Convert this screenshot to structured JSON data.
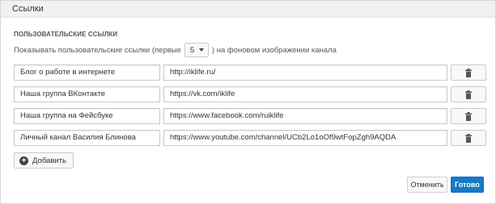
{
  "panel": {
    "title": "Ссылки"
  },
  "section": {
    "title": "ПОЛЬЗОВАТЕЛЬСКИЕ ССЫЛКИ"
  },
  "show": {
    "prefix": "Показывать пользовательские ссылки (первые",
    "selected": "5",
    "suffix": ") на фоновом изображении канала"
  },
  "links": [
    {
      "name": "Блог о работе в интернете",
      "url": "http://iklife.ru/"
    },
    {
      "name": "Наша группа ВКонтакте",
      "url": "https://vk.com/iklife"
    },
    {
      "name": "Наша группа на Фейсбуке",
      "url": "https://www.facebook.com/ruiklife"
    },
    {
      "name": "Личный канал Василия Блинова",
      "url": "https://www.youtube.com/channel/UCb2Lo1oOf9wtFopZgh9AQDA"
    }
  ],
  "icons": {
    "delete": "trash-icon",
    "add": "plus-circle-icon",
    "dropdown": "caret-down-icon"
  },
  "buttons": {
    "add": "Добавить",
    "cancel": "Отменить",
    "done": "Готово"
  },
  "colors": {
    "primary": "#167ac6",
    "header_bg": "#f1f1f1"
  }
}
